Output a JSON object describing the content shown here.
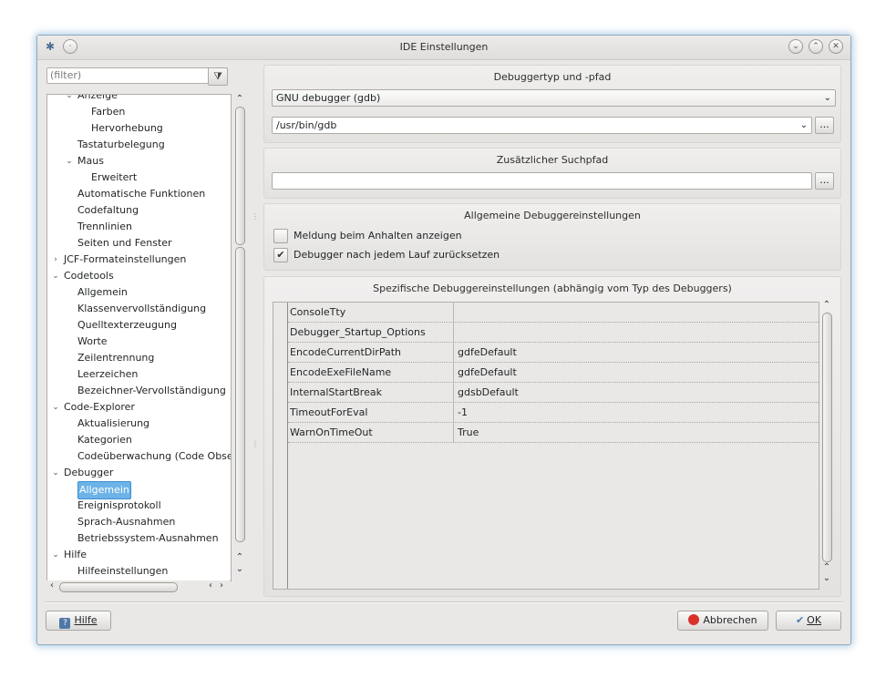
{
  "window": {
    "title": "IDE Einstellungen"
  },
  "sidebar": {
    "filter_placeholder": "(filter)",
    "items": [
      {
        "label": "Anzeige",
        "level": 1,
        "exp": "v"
      },
      {
        "label": "Farben",
        "level": 2
      },
      {
        "label": "Hervorhebung",
        "level": 2
      },
      {
        "label": "Tastaturbelegung",
        "level": 1
      },
      {
        "label": "Maus",
        "level": 1,
        "exp": "v"
      },
      {
        "label": "Erweitert",
        "level": 2
      },
      {
        "label": "Automatische Funktionen",
        "level": 1
      },
      {
        "label": "Codefaltung",
        "level": 1
      },
      {
        "label": "Trennlinien",
        "level": 1
      },
      {
        "label": "Seiten und Fenster",
        "level": 1
      },
      {
        "label": "JCF-Formateinstellungen",
        "level": 0,
        "exp": ">"
      },
      {
        "label": "Codetools",
        "level": 0,
        "exp": "v"
      },
      {
        "label": "Allgemein",
        "level": 1
      },
      {
        "label": "Klassenvervollständigung",
        "level": 1
      },
      {
        "label": "Quelltexterzeugung",
        "level": 1
      },
      {
        "label": "Worte",
        "level": 1
      },
      {
        "label": "Zeilentrennung",
        "level": 1
      },
      {
        "label": "Leerzeichen",
        "level": 1
      },
      {
        "label": "Bezeichner-Vervollständigung",
        "level": 1
      },
      {
        "label": "Code-Explorer",
        "level": 0,
        "exp": "v"
      },
      {
        "label": "Aktualisierung",
        "level": 1
      },
      {
        "label": "Kategorien",
        "level": 1
      },
      {
        "label": "Codeüberwachung (Code Obse",
        "level": 1
      },
      {
        "label": "Debugger",
        "level": 0,
        "exp": "v"
      },
      {
        "label": "Allgemein",
        "level": 1,
        "selected": true
      },
      {
        "label": "Ereignisprotokoll",
        "level": 1
      },
      {
        "label": "Sprach-Ausnahmen",
        "level": 1
      },
      {
        "label": "Betriebssystem-Ausnahmen",
        "level": 1
      },
      {
        "label": "Hilfe",
        "level": 0,
        "exp": "v"
      },
      {
        "label": "Hilfeeinstellungen",
        "level": 1
      }
    ]
  },
  "debugger_type": {
    "title": "Debuggertyp und -pfad",
    "type_value": "GNU debugger (gdb)",
    "path_value": "/usr/bin/gdb",
    "browse_label": "..."
  },
  "search_path": {
    "title": "Zusätzlicher Suchpfad",
    "value": "",
    "browse_label": "..."
  },
  "general": {
    "title": "Allgemeine Debuggereinstellungen",
    "options": [
      {
        "label": "Meldung beim Anhalten anzeigen",
        "checked": false
      },
      {
        "label": "Debugger nach jedem Lauf zurücksetzen",
        "checked": true
      }
    ]
  },
  "specific": {
    "title": "Spezifische Debuggereinstellungen (abhängig vom Typ des Debuggers)",
    "rows": [
      {
        "key": "ConsoleTty",
        "value": ""
      },
      {
        "key": "Debugger_Startup_Options",
        "value": ""
      },
      {
        "key": "EncodeCurrentDirPath",
        "value": "gdfeDefault"
      },
      {
        "key": "EncodeExeFileName",
        "value": "gdfeDefault"
      },
      {
        "key": "InternalStartBreak",
        "value": "gdsbDefault"
      },
      {
        "key": "TimeoutForEval",
        "value": "-1"
      },
      {
        "key": "WarnOnTimeOut",
        "value": "True"
      }
    ]
  },
  "footer": {
    "help_label": "Hilfe",
    "cancel_label": "Abbrechen",
    "ok_label": "OK"
  },
  "colors": {
    "selection": "#6cb3e8",
    "window_bg": "#e9e8e6",
    "cancel_icon": "#d9322b",
    "ok_icon": "#4a78b3"
  },
  "icons": [
    "app-icon",
    "pin-icon",
    "minimize-icon",
    "maximize-icon",
    "close-icon",
    "clear-filter-icon",
    "help-icon",
    "cancel-icon",
    "checkmark-icon"
  ]
}
